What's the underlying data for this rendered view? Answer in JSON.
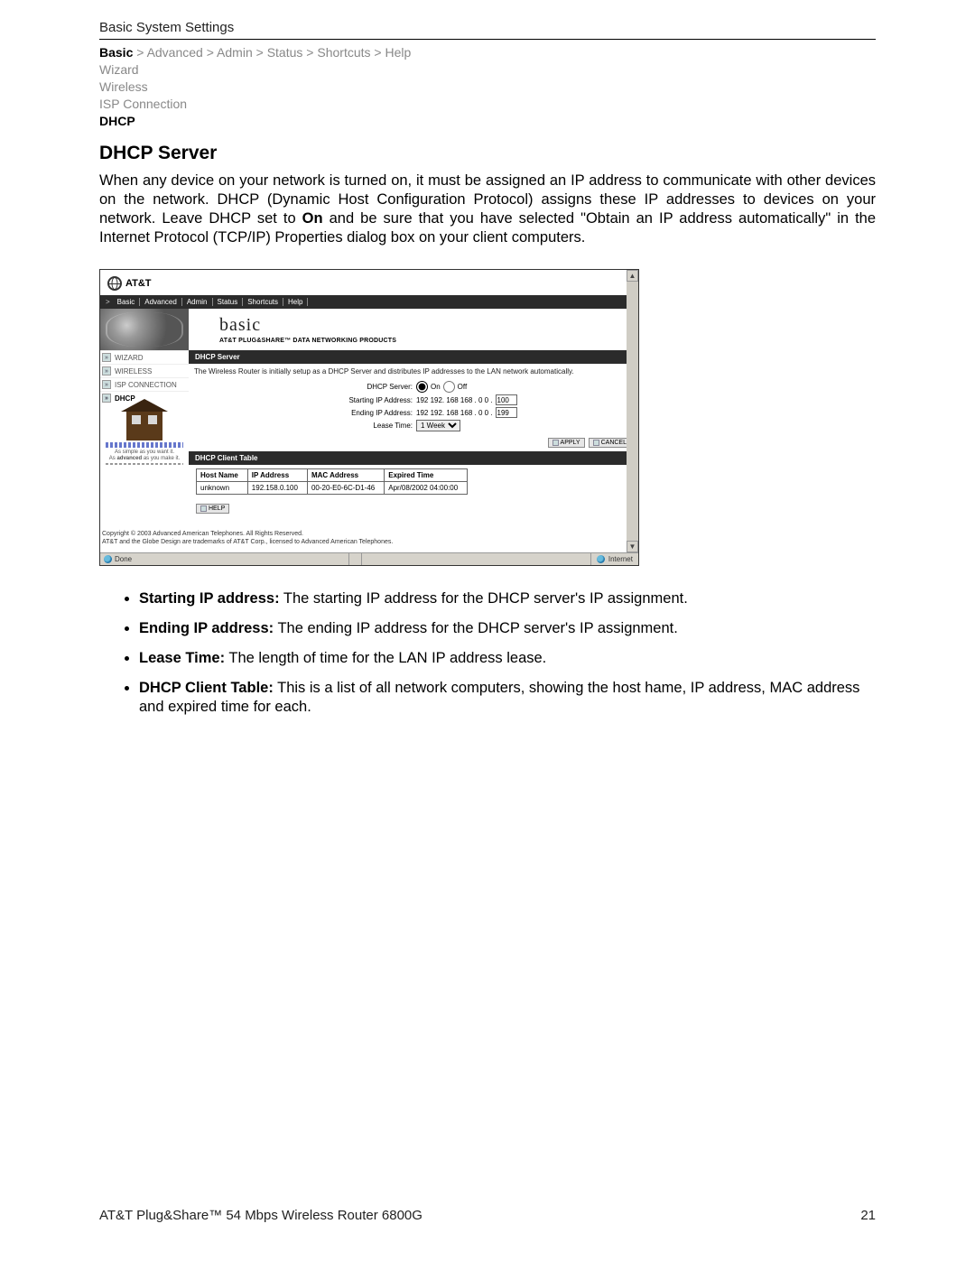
{
  "header": {
    "page_title": "Basic System Settings",
    "breadcrumb": [
      "Basic",
      "Advanced",
      "Admin",
      "Status",
      "Shortcuts",
      "Help"
    ],
    "active_crumb": "Basic",
    "sep": ">",
    "subnav": [
      "Wizard",
      "Wireless",
      "ISP Connection",
      "DHCP"
    ],
    "current_sub": "DHCP"
  },
  "section": {
    "title": "DHCP Server",
    "intro_pre": "When any device on your network is turned on, it must be assigned an IP address to communicate with other devices on the network. DHCP (Dynamic Host Configuration Protocol) assigns these IP addresses to devices on your network. Leave DHCP set to ",
    "intro_bold": "On",
    "intro_post": " and be sure that you have selected \"Obtain an IP address automatically\" in the Internet Protocol (TCP/IP) Properties dialog box on your client computers."
  },
  "shot": {
    "brand": "AT&T",
    "tabs_gt": ">",
    "tabs": [
      "Basic",
      "Advanced",
      "Admin",
      "Status",
      "Shortcuts",
      "Help"
    ],
    "hero_title": "basic",
    "hero_sub": "AT&T PLUG&SHARE™ DATA NETWORKING PRODUCTS",
    "leftnav": [
      {
        "label": "WIZARD"
      },
      {
        "label": "WIRELESS"
      },
      {
        "label": "ISP CONNECTION"
      },
      {
        "label": "DHCP",
        "selected": true
      }
    ],
    "tagline1": "As simple as you want it.",
    "tagline2_pre": "As ",
    "tagline2_bold": "advanced",
    "tagline2_post": " as you make it.",
    "bar_server": "DHCP Server",
    "desc": "The Wireless Router is initially setup as a DHCP Server and distributes IP addresses to the LAN network automatically.",
    "row_server_label": "DHCP Server:",
    "row_server_on": "On",
    "row_server_off": "Off",
    "row_start_label": "Starting IP Address:",
    "row_start_prefix": "192 192. 168 168 . 0 0 .",
    "row_start_value": "100",
    "row_end_label": "Ending IP Address:",
    "row_end_prefix": "192 192. 168 168 . 0 0 .",
    "row_end_value": "199",
    "row_lease_label": "Lease Time:",
    "row_lease_value": "1 Week",
    "btn_apply": "APPLY",
    "btn_cancel": "CANCEL",
    "bar_client": "DHCP Client Table",
    "table": {
      "headers": [
        "Host Name",
        "IP Address",
        "MAC Address",
        "Expired Time"
      ],
      "rows": [
        [
          "unknown",
          "192.158.0.100",
          "00-20-E0-6C-D1-46",
          "Apr/08/2002 04:00:00"
        ]
      ]
    },
    "btn_help": "HELP",
    "copyright1": "Copyright © 2003 Advanced American Telephones. All Rights Reserved.",
    "copyright2": "AT&T and the Globe Design are trademarks of AT&T Corp., licensed to Advanced American Telephones.",
    "status_left": "Done",
    "status_right": "Internet",
    "scroll_up": "▲",
    "scroll_down": "▼"
  },
  "bullets": [
    {
      "b": "Starting IP address:",
      "t": " The starting IP address for the DHCP server's IP assignment."
    },
    {
      "b": "Ending IP address:",
      "t": " The ending IP address for the DHCP server's IP assignment."
    },
    {
      "b": "Lease Time:",
      "t": " The length of time for the LAN IP address lease."
    },
    {
      "b": "DHCP Client Table:",
      "t": " This is a list of all network computers, showing the host hame, IP address, MAC address and expired time for each."
    }
  ],
  "footer": {
    "left": "AT&T Plug&Share™ 54 Mbps Wireless Router 6800G",
    "right": "21"
  }
}
